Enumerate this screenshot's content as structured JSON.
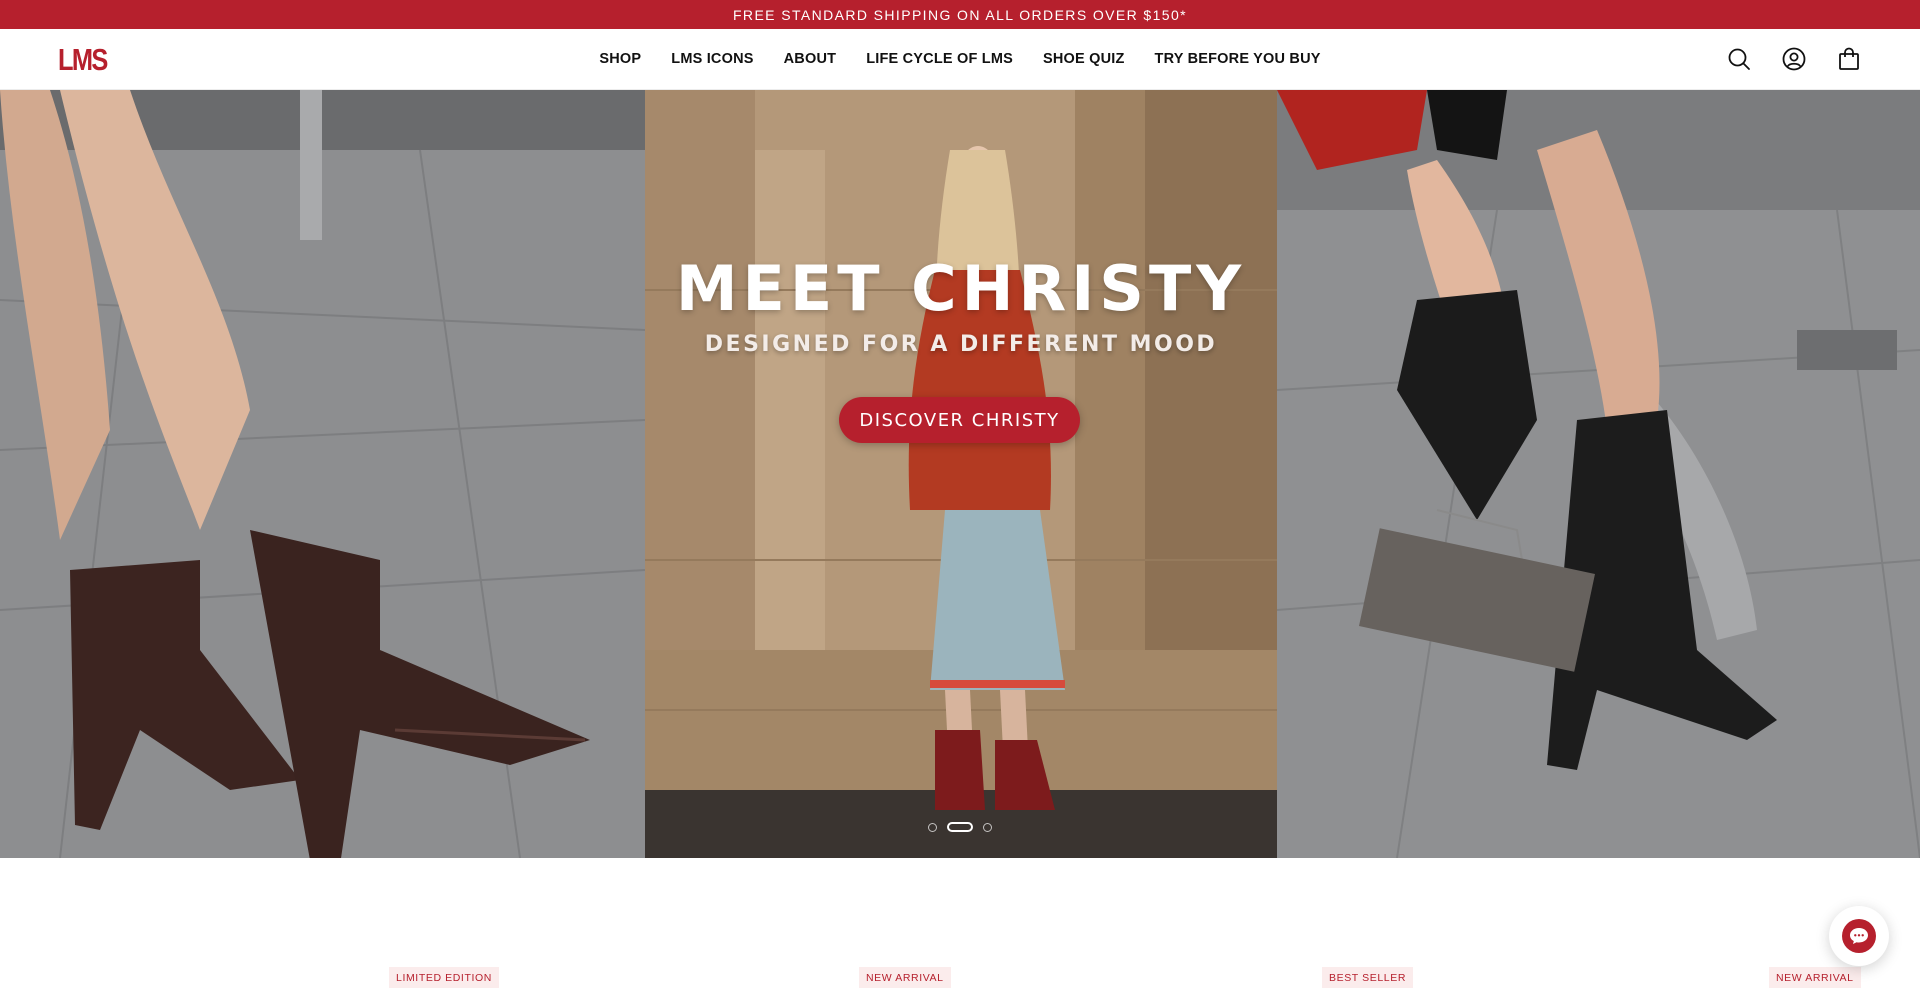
{
  "announcement": "FREE STANDARD SHIPPING ON ALL ORDERS OVER $150*",
  "logo": "LMS",
  "nav": [
    "SHOP",
    "LMS ICONS",
    "ABOUT",
    "LIFE CYCLE OF LMS",
    "SHOE QUIZ",
    "TRY BEFORE YOU BUY"
  ],
  "header_icons": [
    "search-icon",
    "account-icon",
    "cart-icon"
  ],
  "hero": {
    "title": "MEET CHRISTY",
    "subtitle": "DESIGNED FOR A DIFFERENT MOOD",
    "cta": "DISCOVER CHRISTY",
    "slide_count": 3,
    "active_slide": 2
  },
  "badges": [
    "LIMITED EDITION",
    "NEW ARRIVAL",
    "BEST SELLER",
    "NEW ARRIVAL"
  ],
  "colors": {
    "brand": "#b6202d",
    "badge_bg": "#fbecec"
  },
  "chat_icon": "chat-bubble-icon"
}
